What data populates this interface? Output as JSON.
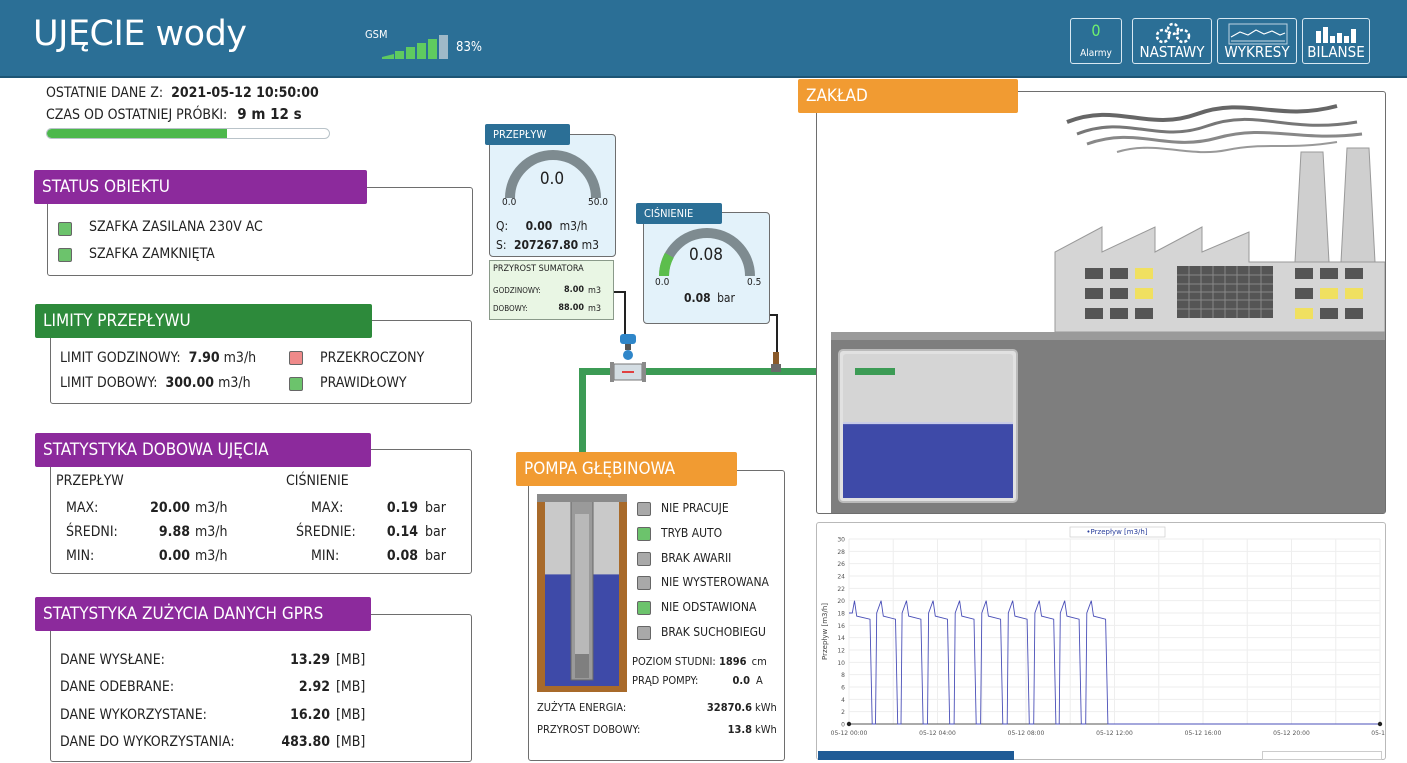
{
  "header": {
    "title": "UJĘCIE wody",
    "gsm_label": "GSM",
    "gsm_signal_percent": 83,
    "gsm_percent_text": "83%",
    "alarms_count": "0",
    "alarms_label": "Alarmy",
    "buttons": {
      "settings": "NASTAWY",
      "charts": "WYKRESY",
      "balances": "BILANSE"
    }
  },
  "last_data": {
    "label": "OSTATNIE DANE Z:",
    "value": "2021-05-12 10:50:00",
    "since_label": "CZAS OD OSTATNIEJ PRÓBKI:",
    "since_value": "9 m 12 s",
    "progress_fraction": 0.64
  },
  "status": {
    "title": "STATUS OBIEKTU",
    "items": [
      {
        "label": "SZAFKA ZASILANA 230V AC",
        "state": "ok"
      },
      {
        "label": "SZAFKA ZAMKNIĘTA",
        "state": "ok"
      }
    ]
  },
  "limits": {
    "title": "LIMITY PRZEPŁYWU",
    "hourly_label": "LIMIT GODZINOWY:",
    "hourly_value": "7.90",
    "hourly_unit": "m3/h",
    "hourly_status": "PRZEKROCZONY",
    "daily_label": "LIMIT DOBOWY:",
    "daily_value": "300.00",
    "daily_unit": "m3/h",
    "daily_status": "PRAWIDŁOWY"
  },
  "daily_stats": {
    "title": "STATYSTYKA DOBOWA UJĘCIA",
    "flow_header": "PRZEPŁYW",
    "pressure_header": "CIŚNIENIE",
    "flow": [
      {
        "label": "MAX:",
        "value": "20.00",
        "unit": "m3/h"
      },
      {
        "label": "ŚREDNI:",
        "value": "9.88",
        "unit": "m3/h"
      },
      {
        "label": "MIN:",
        "value": "0.00",
        "unit": "m3/h"
      }
    ],
    "pressure": [
      {
        "label": "MAX:",
        "value": "0.19",
        "unit": "bar"
      },
      {
        "label": "ŚREDNIE:",
        "value": "0.14",
        "unit": "bar"
      },
      {
        "label": "MIN:",
        "value": "0.08",
        "unit": "bar"
      }
    ]
  },
  "gprs": {
    "title": "STATYSTYKA ZUŻYCIA DANYCH GPRS",
    "rows": [
      {
        "label": "DANE WYSŁANE:",
        "value": "13.29",
        "unit": "[MB]"
      },
      {
        "label": "DANE ODEBRANE:",
        "value": "2.92",
        "unit": "[MB]"
      },
      {
        "label": "DANE WYKORZYSTANE:",
        "value": "16.20",
        "unit": "[MB]"
      },
      {
        "label": "DANE DO WYKORZYSTANIA:",
        "value": "483.80",
        "unit": "[MB]"
      }
    ]
  },
  "flow_gauge": {
    "title": "PRZEPŁYW",
    "value": "0.0",
    "min": "0.0",
    "max": "50.0",
    "q_label": "Q:",
    "q_value": "0.00",
    "q_unit": "m3/h",
    "s_label": "S:",
    "s_value": "207267.80",
    "s_unit": "m3",
    "increment_title": "PRZYROST SUMATORA",
    "hourly_label": "GODZINOWY:",
    "hourly_value": "8.00",
    "hourly_unit": "m3",
    "daily_label": "DOBOWY:",
    "daily_value": "88.00",
    "daily_unit": "m3"
  },
  "pressure_gauge": {
    "title": "CIŚNIENIE",
    "value": "0.08",
    "min": "0.0",
    "max": "0.5",
    "reading": "0.08",
    "unit": "bar",
    "fraction": 0.16
  },
  "pump": {
    "title": "POMPA GŁĘBINOWA",
    "states": [
      {
        "label": "NIE PRACUJE",
        "state": "off"
      },
      {
        "label": "TRYB AUTO",
        "state": "on"
      },
      {
        "label": "BRAK AWARII",
        "state": "off"
      },
      {
        "label": "NIE WYSTEROWANA",
        "state": "off"
      },
      {
        "label": "NIE ODSTAWIONA",
        "state": "on"
      },
      {
        "label": "BRAK SUCHOBIEGU",
        "state": "off"
      }
    ],
    "well_level_label": "POZIOM STUDNI:",
    "well_level_value": "1896",
    "well_level_unit": "cm",
    "current_label": "PRĄD POMPY:",
    "current_value": "0.0",
    "current_unit": "A",
    "energy_label": "ZUŻYTA ENERGIA:",
    "energy_value": "32870.6",
    "energy_unit": "kWh",
    "daily_label": "PRZYROST DOBOWY:",
    "daily_value": "13.8",
    "daily_unit": "kWh",
    "water_fraction": 0.6
  },
  "plant": {
    "title": "ZAKŁAD",
    "tank_fill_fraction": 0.52
  },
  "colors": {
    "header": "#2b6f96",
    "purple": "#8c2a9c",
    "green": "#2d8a3b",
    "orange": "#f19b32",
    "ok": "#6cc36c",
    "alarm": "#ef8a8a",
    "water": "#3e4aa8",
    "pipe": "#3c9b55"
  },
  "chart_data": {
    "type": "line",
    "legend": [
      "Przepływ [m3/h]"
    ],
    "ylabel": "Przepływ [m3/h]",
    "ylim": [
      0,
      30
    ],
    "yticks": [
      0,
      2,
      4,
      6,
      8,
      10,
      12,
      14,
      16,
      18,
      20,
      22,
      24,
      26,
      28,
      30
    ],
    "xlim": [
      "05-12 00:00",
      "05-13 00:00"
    ],
    "xticks": [
      "05-12 00:00",
      "05-12 04:00",
      "05-12 08:00",
      "05-12 12:00",
      "05-12 16:00",
      "05-12 20:00",
      "05-13"
    ],
    "series": [
      {
        "name": "Przepływ [m3/h]",
        "points_hours": [
          [
            0.0,
            18
          ],
          [
            0.15,
            18
          ],
          [
            0.25,
            20
          ],
          [
            0.35,
            17.5
          ],
          [
            0.95,
            17
          ],
          [
            1.05,
            0
          ],
          [
            1.2,
            0
          ],
          [
            1.25,
            18
          ],
          [
            1.45,
            20
          ],
          [
            1.55,
            17.5
          ],
          [
            2.1,
            17
          ],
          [
            2.2,
            0
          ],
          [
            2.35,
            0
          ],
          [
            2.4,
            18
          ],
          [
            2.6,
            20
          ],
          [
            2.7,
            17.5
          ],
          [
            3.25,
            17
          ],
          [
            3.35,
            0
          ],
          [
            3.55,
            0
          ],
          [
            3.6,
            18
          ],
          [
            3.8,
            20
          ],
          [
            3.9,
            17.5
          ],
          [
            4.45,
            17
          ],
          [
            4.55,
            0
          ],
          [
            4.75,
            0
          ],
          [
            4.8,
            18
          ],
          [
            5.0,
            20
          ],
          [
            5.1,
            17.5
          ],
          [
            5.65,
            17
          ],
          [
            5.75,
            0
          ],
          [
            5.95,
            0
          ],
          [
            6.0,
            18
          ],
          [
            6.2,
            20
          ],
          [
            6.3,
            17.5
          ],
          [
            6.85,
            17
          ],
          [
            6.95,
            0
          ],
          [
            7.15,
            0
          ],
          [
            7.2,
            18
          ],
          [
            7.4,
            20
          ],
          [
            7.5,
            17.5
          ],
          [
            8.05,
            17
          ],
          [
            8.15,
            0
          ],
          [
            8.35,
            0
          ],
          [
            8.4,
            18
          ],
          [
            8.6,
            20
          ],
          [
            8.7,
            17.5
          ],
          [
            9.25,
            17
          ],
          [
            9.35,
            0
          ],
          [
            9.5,
            0
          ],
          [
            9.55,
            18
          ],
          [
            9.75,
            20
          ],
          [
            9.85,
            17.5
          ],
          [
            10.4,
            17
          ],
          [
            10.5,
            0
          ],
          [
            10.7,
            0
          ],
          [
            10.75,
            18
          ],
          [
            10.95,
            20
          ],
          [
            11.05,
            17.5
          ],
          [
            11.6,
            17
          ],
          [
            11.7,
            0
          ],
          [
            24.0,
            0
          ]
        ]
      }
    ]
  }
}
